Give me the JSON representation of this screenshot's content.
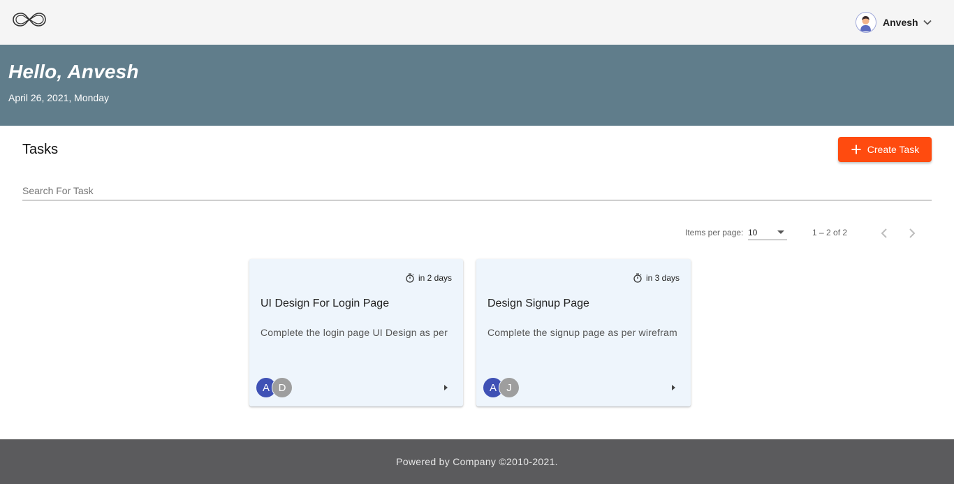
{
  "header": {
    "logo_icon": "infinity-logo-icon",
    "user": {
      "name": "Anvesh",
      "avatar_icon": "user-avatar-icon",
      "menu_icon": "chevron-down-icon"
    }
  },
  "hero": {
    "greeting": "Hello, Anvesh",
    "date": "April 26, 2021, Monday"
  },
  "tasks": {
    "title": "Tasks",
    "create_button": {
      "label": "Create Task",
      "icon": "plus-icon",
      "color": "#ff4b0f"
    },
    "search": {
      "placeholder": "Search For Task",
      "value": ""
    },
    "paginator": {
      "items_per_page_label": "Items per page:",
      "items_per_page_value": "10",
      "range_label": "1 – 2 of 2",
      "prev_icon": "chevron-left-icon",
      "next_icon": "chevron-right-icon"
    },
    "cards": [
      {
        "due": "in 2 days",
        "due_icon": "timer-icon",
        "title": "UI Design For Login Page",
        "description": "Complete the login page UI Design as per",
        "assignees": [
          "A",
          "D"
        ],
        "open_icon": "arrow-right-icon"
      },
      {
        "due": "in 3 days",
        "due_icon": "timer-icon",
        "title": "Design Signup Page",
        "description": "Complete the signup page as per wirefram",
        "assignees": [
          "A",
          "J"
        ],
        "open_icon": "arrow-right-icon"
      }
    ]
  },
  "footer": {
    "text": "Powered by Company ©2010-2021."
  },
  "colors": {
    "topbar": "#f5f5f5",
    "hero": "#607d8b",
    "card": "#eef5fc",
    "footer": "#5b5b5d",
    "avatar_primary": "#3f51b5",
    "avatar_secondary": "#9e9e9e"
  }
}
